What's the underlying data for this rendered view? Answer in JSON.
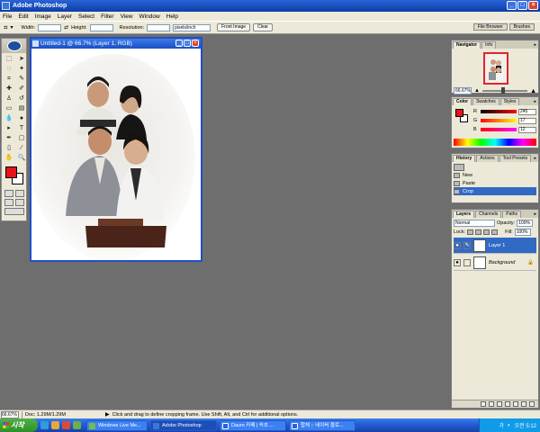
{
  "app": {
    "title": "Adobe Photoshop",
    "menu": [
      "File",
      "Edit",
      "Image",
      "Layer",
      "Select",
      "Filter",
      "View",
      "Window",
      "Help"
    ],
    "window_buttons": [
      "_",
      "□",
      "×"
    ]
  },
  "options_bar": {
    "width_label": "Width:",
    "height_label": "Height:",
    "resolution_label": "Resolution:",
    "resolution_unit": "pixels/inch",
    "front_image_label": "Front Image",
    "clear_label": "Clear",
    "well_tabs": [
      "File Browser",
      "Brushes"
    ]
  },
  "document": {
    "title": "Untitled-1 @ 66.7% (Layer 1, RGB)"
  },
  "navigator": {
    "tabs": [
      "Navigator",
      "Info"
    ],
    "zoom": "66.67%"
  },
  "color_palette": {
    "tabs": [
      "Color",
      "Swatches",
      "Styles"
    ],
    "channels": [
      {
        "label": "R",
        "value": "245"
      },
      {
        "label": "G",
        "value": "17"
      },
      {
        "label": "B",
        "value": "12"
      }
    ],
    "foreground": "#e8121a",
    "background": "#ffffff"
  },
  "history_palette": {
    "tabs": [
      "History",
      "Actions",
      "Tool Presets"
    ],
    "items": [
      "New",
      "Paste",
      "Crop"
    ]
  },
  "layers_palette": {
    "tabs": [
      "Layers",
      "Channels",
      "Paths"
    ],
    "blend_mode": "Normal",
    "opacity_label": "Opacity:",
    "opacity": "100%",
    "lock_label": "Lock:",
    "fill_label": "Fill:",
    "fill": "100%",
    "layers": [
      {
        "name": "Layer 1"
      },
      {
        "name": "Background"
      }
    ]
  },
  "status_bar": {
    "zoom": "66.67%",
    "doc_size": "Doc: 1.29M/1.29M",
    "hint": "Click and drag to define cropping frame. Use Shift, Alt, and Ctrl for additional options."
  },
  "taskbar": {
    "start_label": "시작",
    "buttons": [
      {
        "label": "Windows Live Me..."
      },
      {
        "label": "Adobe Photoshop"
      },
      {
        "label": "Daum 카페 | 속초 ..."
      },
      {
        "label": "합체 :: 네이버 블로..."
      }
    ],
    "clock": "오전 5:12",
    "tray_char": "가"
  }
}
